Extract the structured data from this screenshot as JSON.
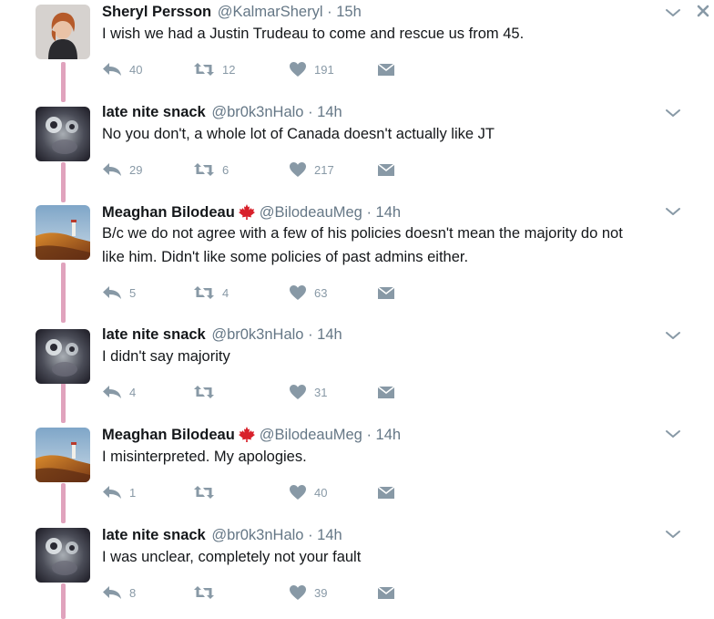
{
  "tweets": [
    {
      "name": "Sheryl Persson",
      "verified_flag": false,
      "handle": "@KalmarSheryl",
      "dot": "·",
      "time": "15h",
      "text": [
        "I wish we had a Justin Trudeau to come and rescue us from 45."
      ],
      "replies": "40",
      "retweets": "12",
      "likes": "191",
      "avatar": "woman-portrait"
    },
    {
      "name": "late nite snack",
      "verified_flag": false,
      "handle": "@br0k3nHalo",
      "dot": "·",
      "time": "14h",
      "text": [
        "No you don't, a whole lot of Canada doesn't actually like JT"
      ],
      "replies": "29",
      "retweets": "6",
      "likes": "217",
      "avatar": "blurry-face"
    },
    {
      "name": "Meaghan Bilodeau",
      "verified_flag": true,
      "handle": "@BilodeauMeg",
      "dot": "·",
      "time": "14h",
      "text": [
        "B/c we do not agree with a few of his policies doesn't mean the majority do not",
        "like him. Didn't like some policies of past admins either."
      ],
      "replies": "5",
      "retweets": "4",
      "likes": "63",
      "avatar": "lighthouse-coast"
    },
    {
      "name": "late nite snack",
      "verified_flag": false,
      "handle": "@br0k3nHalo",
      "dot": "·",
      "time": "14h",
      "text": [
        "I didn't say majority"
      ],
      "replies": "4",
      "retweets": "",
      "likes": "31",
      "avatar": "blurry-face"
    },
    {
      "name": "Meaghan Bilodeau",
      "verified_flag": true,
      "handle": "@BilodeauMeg",
      "dot": "·",
      "time": "14h",
      "text": [
        "I misinterpreted. My apologies."
      ],
      "replies": "1",
      "retweets": "",
      "likes": "40",
      "avatar": "lighthouse-coast"
    },
    {
      "name": "late nite snack",
      "verified_flag": false,
      "handle": "@br0k3nHalo",
      "dot": "·",
      "time": "14h",
      "text": [
        "I was unclear, completely not your fault"
      ],
      "replies": "8",
      "retweets": "",
      "likes": "39",
      "avatar": "blurry-face"
    }
  ],
  "colors": {
    "thread_line": "#e0a3bd",
    "action_gray": "#8899a6",
    "meta_gray": "#657786",
    "flag_red": "#d8202a"
  },
  "icons": {
    "reply": "reply-icon",
    "retweet": "retweet-icon",
    "like": "heart-icon",
    "dm": "envelope-icon",
    "caret": "chevron-down-icon",
    "close": "close-icon",
    "flag": "maple-leaf-icon"
  }
}
